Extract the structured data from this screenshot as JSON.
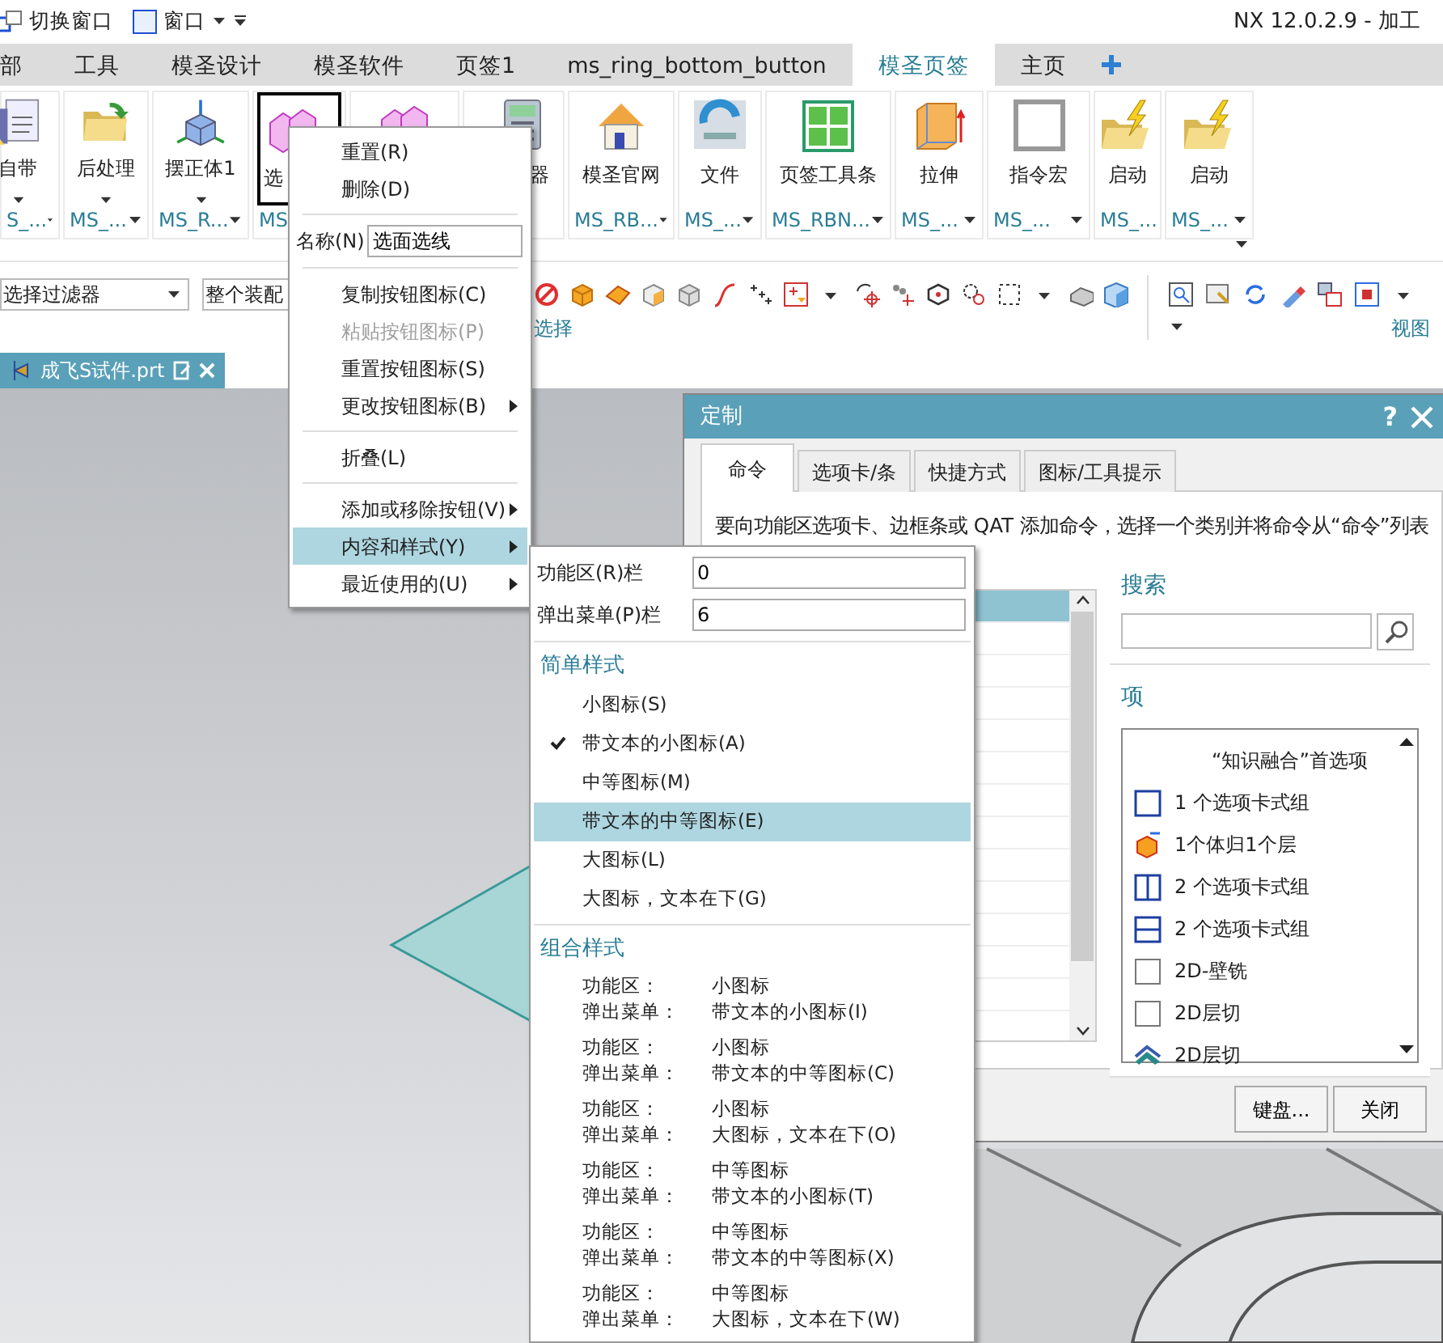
{
  "title_bar": {
    "quick_access": [
      {
        "label": "切换窗口"
      },
      {
        "label": "窗口"
      }
    ],
    "title": "NX 12.0.2.9 - 加工"
  },
  "ribbon_tabs": [
    {
      "label": "部",
      "selected": false
    },
    {
      "label": "工具",
      "selected": false
    },
    {
      "label": "模圣设计",
      "selected": false
    },
    {
      "label": "模圣软件",
      "selected": false
    },
    {
      "label": "页签1",
      "selected": false
    },
    {
      "label": "ms_ring_bottom_button",
      "selected": false
    },
    {
      "label": "模圣页签",
      "selected": true
    },
    {
      "label": "主页",
      "selected": false
    }
  ],
  "ribbon_buttons": [
    {
      "label": "自带",
      "group": "S_...",
      "has_menu": true,
      "outlined": false
    },
    {
      "label": "后处理",
      "group": "MS_...",
      "has_menu": true,
      "outlined": false
    },
    {
      "label": "摆正体1",
      "group": "MS_R...",
      "has_menu": true,
      "outlined": false
    },
    {
      "label": "选",
      "group": "MS",
      "has_menu": false,
      "outlined": true
    },
    {
      "outlined": false
    },
    {
      "label": "器",
      "has_menu": false,
      "outlined": false
    },
    {
      "label": "模圣官网",
      "group": "MS_RB...",
      "has_menu": false,
      "outlined": false
    },
    {
      "label": "文件",
      "group": "MS_...",
      "has_menu": false,
      "outlined": false
    },
    {
      "label": "页签工具条",
      "group": "MS_RBN...",
      "has_menu": false,
      "outlined": false
    },
    {
      "label": "拉伸",
      "group": "MS_...",
      "has_menu": false,
      "outlined": false
    },
    {
      "label": "指令宏",
      "group": "MS_...",
      "has_menu": false,
      "outlined": false
    },
    {
      "label": "启动",
      "group": "MS_...",
      "has_menu": false,
      "outlined": false
    },
    {
      "label": "启动",
      "group": "MS_...",
      "has_menu": false,
      "outlined": false
    }
  ],
  "toolbar": {
    "filters": [
      {
        "value": "选择过滤器"
      },
      {
        "value": "整个装配"
      }
    ],
    "groups": [
      {
        "label": "选择"
      },
      {
        "label": "视图"
      }
    ]
  },
  "document_tab": {
    "label": "成飞S试件.prt"
  },
  "context_menu": {
    "items": [
      {
        "kind": "item",
        "label": "重置(R)",
        "disabled": false,
        "submenu": false,
        "selected": false
      },
      {
        "kind": "item",
        "label": "删除(D)",
        "disabled": false,
        "submenu": false,
        "selected": false
      },
      {
        "kind": "separator"
      },
      {
        "kind": "field",
        "label": "名称(N)",
        "value": "选面选线"
      },
      {
        "kind": "separator"
      },
      {
        "kind": "item",
        "label": "复制按钮图标(C)",
        "disabled": false,
        "submenu": false,
        "selected": false
      },
      {
        "kind": "item",
        "label": "粘贴按钮图标(P)",
        "disabled": true,
        "submenu": false,
        "selected": false
      },
      {
        "kind": "item",
        "label": "重置按钮图标(S)",
        "disabled": false,
        "submenu": false,
        "selected": false
      },
      {
        "kind": "item",
        "label": "更改按钮图标(B)",
        "disabled": false,
        "submenu": true,
        "selected": false
      },
      {
        "kind": "separator"
      },
      {
        "kind": "item",
        "label": "折叠(L)",
        "disabled": false,
        "submenu": false,
        "selected": false
      },
      {
        "kind": "separator"
      },
      {
        "kind": "item",
        "label": "添加或移除按钮(V)",
        "disabled": false,
        "submenu": true,
        "selected": false
      },
      {
        "kind": "item",
        "label": "内容和样式(Y)",
        "disabled": false,
        "submenu": true,
        "selected": true
      },
      {
        "kind": "item",
        "label": "最近使用的(U)",
        "disabled": false,
        "submenu": true,
        "selected": false
      }
    ]
  },
  "style_menu": {
    "fields": [
      {
        "label": "功能区(R)栏",
        "value": "0"
      },
      {
        "label": "弹出菜单(P)栏",
        "value": "6"
      }
    ],
    "simple_title": "简单样式",
    "simple_styles": [
      {
        "label": "小图标(S)",
        "checked": false,
        "selected": false
      },
      {
        "label": "带文本的小图标(A)",
        "checked": true,
        "selected": false
      },
      {
        "label": "中等图标(M)",
        "checked": false,
        "selected": false
      },
      {
        "label": "带文本的中等图标(E)",
        "checked": false,
        "selected": true
      },
      {
        "label": "大图标(L)",
        "checked": false,
        "selected": false
      },
      {
        "label": "大图标，文本在下(G)",
        "checked": false,
        "selected": false
      }
    ],
    "combined_title": "组合样式",
    "combined_styles": [
      {
        "ribbon_label": "功能区：",
        "ribbon_value": "小图标",
        "popup_label": "弹出菜单：",
        "popup_value": "带文本的小图标(I)"
      },
      {
        "ribbon_label": "功能区：",
        "ribbon_value": "小图标",
        "popup_label": "弹出菜单：",
        "popup_value": "带文本的中等图标(C)"
      },
      {
        "ribbon_label": "功能区：",
        "ribbon_value": "小图标",
        "popup_label": "弹出菜单：",
        "popup_value": "大图标，文本在下(O)"
      },
      {
        "ribbon_label": "功能区：",
        "ribbon_value": "中等图标",
        "popup_label": "弹出菜单：",
        "popup_value": "带文本的小图标(T)"
      },
      {
        "ribbon_label": "功能区：",
        "ribbon_value": "中等图标",
        "popup_label": "弹出菜单：",
        "popup_value": "带文本的中等图标(X)"
      },
      {
        "ribbon_label": "功能区：",
        "ribbon_value": "中等图标",
        "popup_label": "弹出菜单：",
        "popup_value": "大图标，文本在下(W)"
      }
    ]
  },
  "dialog": {
    "title": "定制",
    "help": "?",
    "tabs": [
      {
        "label": "命令",
        "selected": true
      },
      {
        "label": "选项卡/条",
        "selected": false
      },
      {
        "label": "快捷方式",
        "selected": false
      },
      {
        "label": "图标/工具提示",
        "selected": false
      }
    ],
    "description": "要向功能区选项卡、边框条或 QAT 添加命令，选择一个类别并将命令从“命令”列表",
    "categories": [
      {
        "selected": true
      },
      {
        "selected": false
      },
      {
        "selected": false
      },
      {
        "selected": false
      },
      {
        "selected": false
      },
      {
        "selected": false
      },
      {
        "selected": false
      },
      {
        "selected": false
      },
      {
        "selected": false
      },
      {
        "selected": false
      },
      {
        "selected": false
      },
      {
        "selected": false
      },
      {
        "selected": false
      }
    ],
    "search_label": "搜索",
    "items_label": "项",
    "items": [
      {
        "kind": "none",
        "label": "“知识融合”首选项"
      },
      {
        "kind": "tab-group",
        "label": "1 个选项卡式组"
      },
      {
        "kind": "cube",
        "label": "1个体归1个层"
      },
      {
        "kind": "split-v",
        "label": "2 个选项卡式组"
      },
      {
        "kind": "split-h",
        "label": "2 个选项卡式组"
      },
      {
        "kind": "blank",
        "label": "2D-壁铣"
      },
      {
        "kind": "blank",
        "label": "2D层切"
      },
      {
        "kind": "layers",
        "label": "2D层切"
      }
    ],
    "buttons": [
      {
        "label": "键盘..."
      },
      {
        "label": "关闭"
      }
    ]
  }
}
